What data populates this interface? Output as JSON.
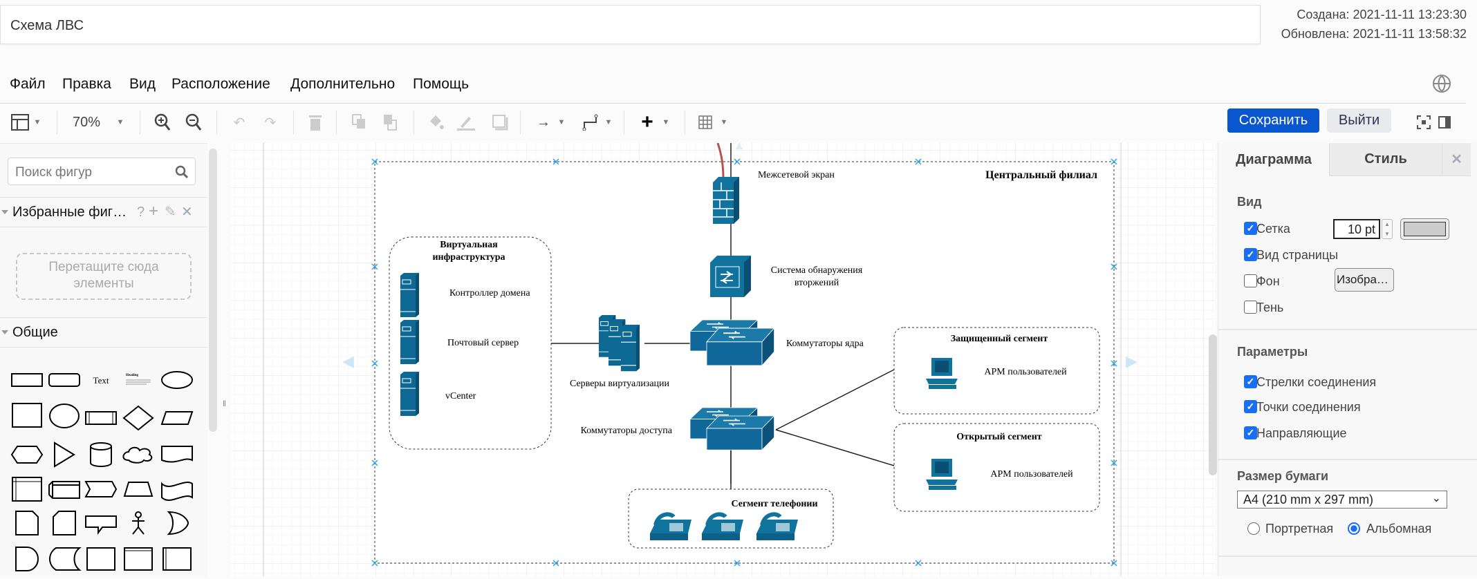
{
  "document": {
    "title": "Схема ЛВС",
    "created": "Создана: 2021-11-11 13:23:30",
    "updated": "Обновлена: 2021-11-11 13:58:32"
  },
  "menu": [
    "Файл",
    "Правка",
    "Вид",
    "Расположение",
    "Дополнительно",
    "Помощь"
  ],
  "toolbar": {
    "zoom": "70%",
    "save_label": "Сохранить",
    "exit_label": "Выйти",
    "icons": [
      "format-panel-icon",
      "zoom-in-icon",
      "zoom-out-icon",
      "undo-icon",
      "redo-icon",
      "delete-icon",
      "to-front-icon",
      "to-back-icon",
      "fill-color-icon",
      "line-color-icon",
      "shadow-icon",
      "connection-arrow-icon",
      "waypoints-icon",
      "insert-plus-icon",
      "table-icon",
      "globe-icon",
      "fullscreen-icon",
      "toggle-panel-icon"
    ]
  },
  "sidebar": {
    "search_placeholder": "Поиск фигур",
    "favorites_title": "Избранные фиг…",
    "favorites_help": "?",
    "drop_hint": "Перетащите сюда элементы",
    "general_title": "Общие",
    "text_shape": "Text",
    "heading_shape": "Heading",
    "shapes": [
      "rectangle",
      "rounded-rectangle",
      "text",
      "textbox",
      "ellipse",
      "square",
      "circle",
      "process",
      "diamond",
      "parallelogram",
      "hexagon",
      "triangle",
      "cylinder",
      "cloud",
      "document",
      "internal-storage",
      "cube",
      "step",
      "trapezoid",
      "tape",
      "note",
      "card",
      "callout",
      "actor",
      "or",
      "delay",
      "data-storage",
      "square-2",
      "container",
      "list"
    ]
  },
  "diagram": {
    "outer_title": "Центральный филиал",
    "firewall": "Межсетевой экран",
    "ids_line1": "Система обнаружения",
    "ids_line2": "вторжений",
    "core_switches": "Коммутаторы ядра",
    "access_switches": "Коммутаторы доступа",
    "virt_servers": "Серверы виртуализации",
    "virt_title1": "Виртуальная",
    "virt_title2": "инфраструктура",
    "dc": "Контроллер домена",
    "mail": "Почтовый сервер",
    "vcenter": "vCenter",
    "protected_title": "Защищенный сегмент",
    "open_title": "Открытый сегмент",
    "workstations": "АРМ пользователей",
    "phones_title": "Сегмент телефонии",
    "icon_color": "#10739e",
    "connector_red": "#b85450"
  },
  "panel": {
    "tab_diagram": "Диаграмма",
    "tab_style": "Стиль",
    "view_title": "Вид",
    "grid": "Сетка",
    "grid_size": "10 pt",
    "page_view": "Вид страницы",
    "background": "Фон",
    "image_btn": "Изобра…",
    "shadow": "Тень",
    "options_title": "Параметры",
    "conn_arrows": "Стрелки соединения",
    "conn_points": "Точки соединения",
    "guides": "Направляющие",
    "paper_title": "Размер бумаги",
    "paper": "A4 (210 mm x 297 mm)",
    "portrait": "Портретная",
    "landscape": "Альбомная",
    "checks": {
      "grid": true,
      "page_view": true,
      "background": false,
      "shadow": false,
      "conn_arrows": true,
      "conn_points": true,
      "guides": true
    },
    "orientation": "landscape",
    "accent": "#1a6ef5"
  }
}
